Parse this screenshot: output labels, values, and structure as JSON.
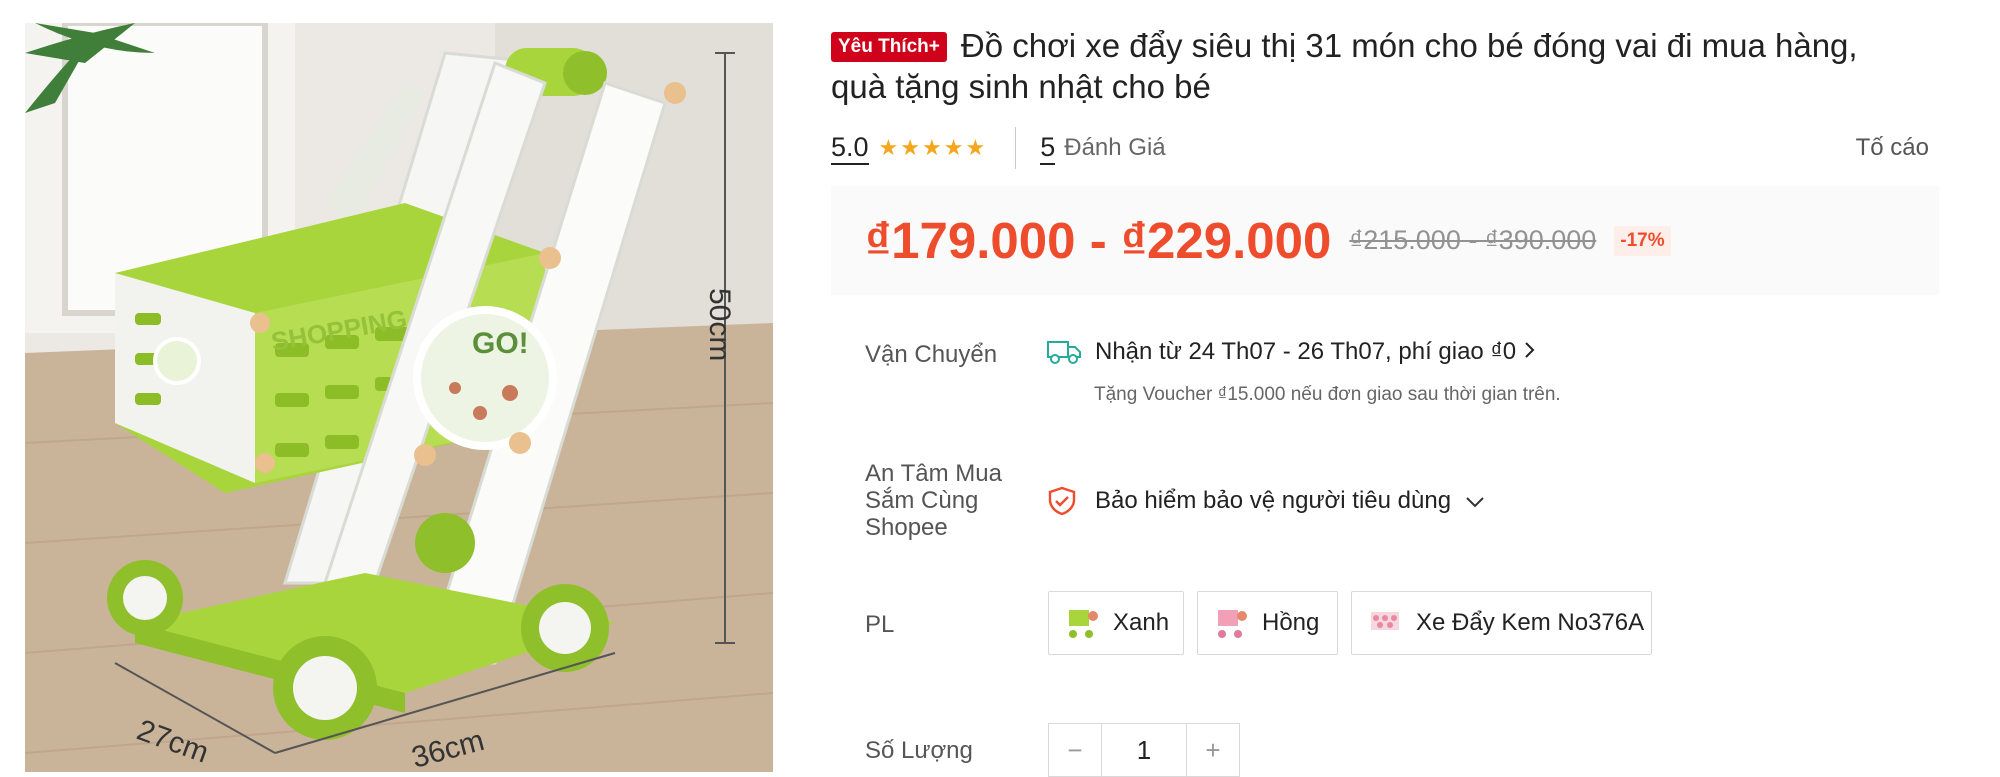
{
  "product": {
    "badge": "Yêu Thích+",
    "title_line1": "Đồ chơi xe đẩy siêu thị 31 món cho bé đóng vai đi mua hàng,",
    "title_line2": "quà tặng sinh nhật cho bé",
    "image_alt": "Xe đẩy siêu thị đồ chơi màu xanh",
    "image_labels": {
      "height": "50cm",
      "depth": "27cm",
      "width": "36cm",
      "sign": "GO!",
      "basket_text": "SHOPPING"
    }
  },
  "rating": {
    "score": "5.0",
    "stars": 5,
    "review_count": "5",
    "review_label": "Đánh Giá",
    "report_label": "Tố cáo"
  },
  "price": {
    "current": "₫179.000 - ₫229.000",
    "original": "₫215.000 - ₫390.000",
    "discount": "-17%"
  },
  "shipping": {
    "label": "Vận Chuyển",
    "main": "Nhận từ 24 Th07 - 26 Th07, phí giao ₫0",
    "note": "Tặng Voucher ₫15.000 nếu đơn giao sau thời gian trên."
  },
  "protection": {
    "label_line1": "An Tâm Mua",
    "label_line2": "Sắm Cùng",
    "label_line3": "Shopee",
    "text": "Bảo hiểm bảo vệ người tiêu dùng"
  },
  "variants": {
    "label": "PL",
    "options": [
      "Xanh",
      "Hồng",
      "Xe Đẩy Kem No376A"
    ]
  },
  "quantity": {
    "label": "Số Lượng",
    "value": "1",
    "minus": "−",
    "plus": "+"
  },
  "colors": {
    "accent": "#ee4d2d",
    "badge": "#d0011b",
    "cart_green": "#a8d43c"
  }
}
